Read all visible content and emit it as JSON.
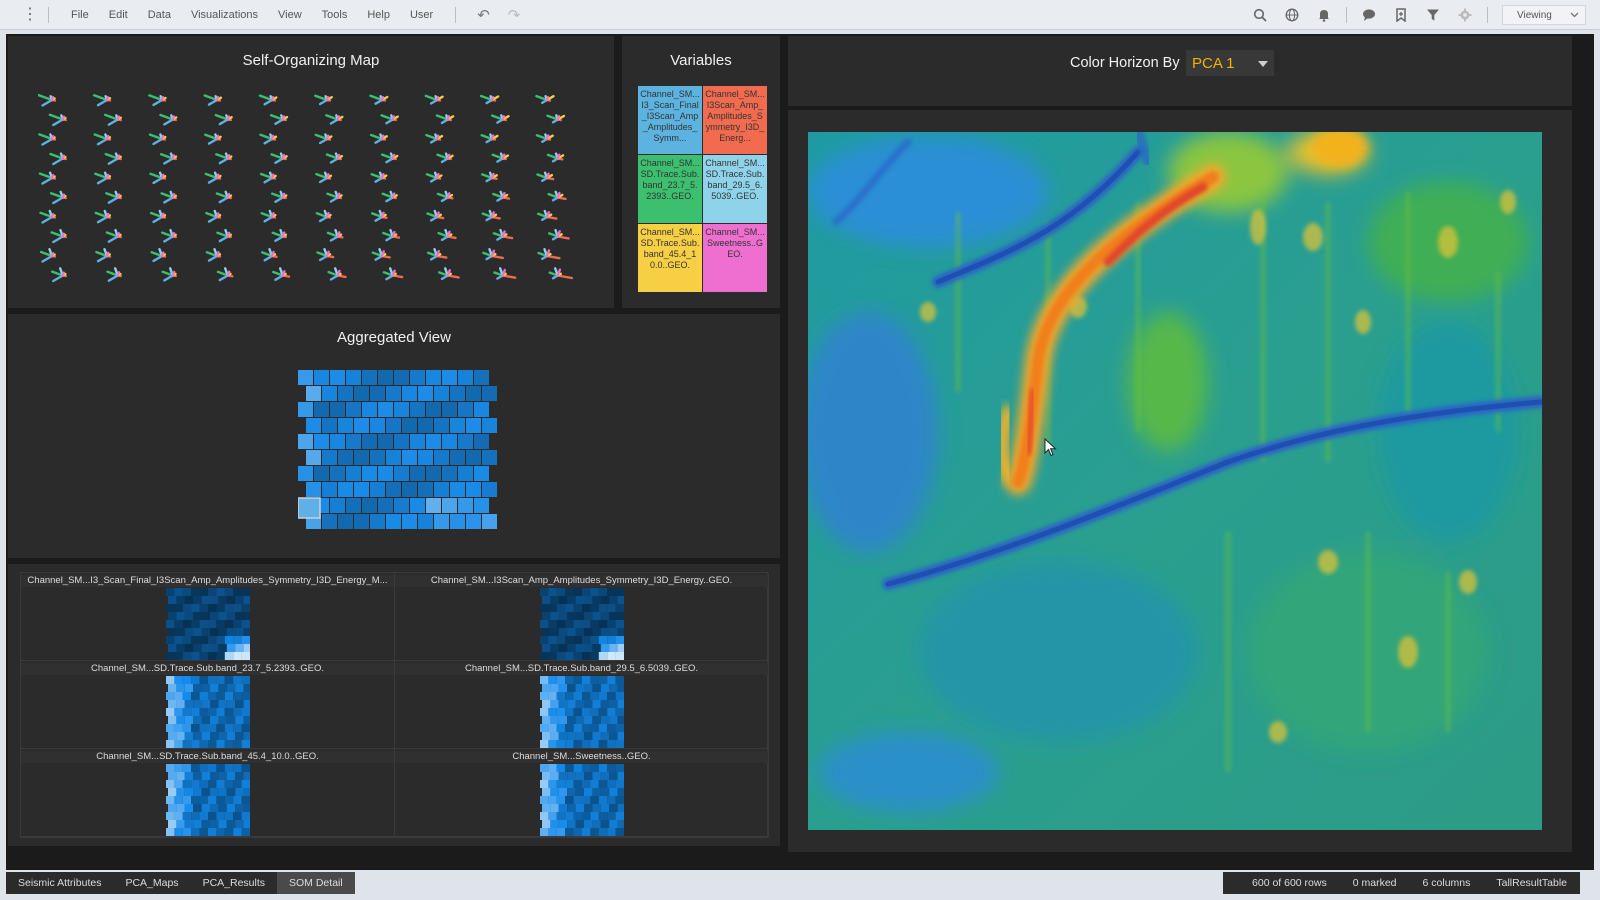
{
  "menubar": {
    "menu_items": [
      "File",
      "Edit",
      "Data",
      "Visualizations",
      "View",
      "Tools",
      "Help",
      "User"
    ],
    "icons": [
      "search-icon",
      "globe-icon",
      "bell-icon",
      "chat-icon",
      "bookmark-icon",
      "filter-icon",
      "gear-icon"
    ],
    "view_mode": "Viewing"
  },
  "som": {
    "title": "Self-Organizing Map",
    "rows": 10,
    "cols": 10
  },
  "variables": {
    "title": "Variables",
    "items": [
      {
        "label": "Channel_SM...I3_Scan_Final_I3Scan_Amp_Amplitudes_Symm...",
        "color": "#5db3df"
      },
      {
        "label": "Channel_SM...I3Scan_Amp_Amplitudes_Symmetry_I3D_Energ...",
        "color": "#f26b4f"
      },
      {
        "label": "Channel_SM...SD.Trace.Sub.band_23.7_5.2393..GEO.",
        "color": "#3cbf6e"
      },
      {
        "label": "Channel_SM...SD.Trace.Sub.band_29.5_6.5039..GEO.",
        "color": "#8fd3ea"
      },
      {
        "label": "Channel_SM...SD.Trace.Sub.band_45.4_10.0..GEO.",
        "color": "#f7cf45"
      },
      {
        "label": "Channel_SM...Sweetness..GEO.",
        "color": "#ee6fd0"
      }
    ]
  },
  "aggregated": {
    "title": "Aggregated View",
    "rows": 10,
    "cols": 12
  },
  "som_detail": {
    "cells": [
      "Channel_SM...I3_Scan_Final_I3Scan_Amp_Amplitudes_Symmetry_I3D_Energy_M...",
      "Channel_SM...I3Scan_Amp_Amplitudes_Symmetry_I3D_Energy..GEO.",
      "Channel_SM...SD.Trace.Sub.band_23.7_5.2393..GEO.",
      "Channel_SM...SD.Trace.Sub.band_29.5_6.5039..GEO.",
      "Channel_SM...SD.Trace.Sub.band_45.4_10.0..GEO.",
      "Channel_SM...Sweetness..GEO."
    ]
  },
  "color_horizon": {
    "label": "Color Horizon By",
    "selected": "PCA 1"
  },
  "tabs": [
    {
      "label": "Seismic Attributes",
      "active": false
    },
    {
      "label": "PCA_Maps",
      "active": false
    },
    {
      "label": "PCA_Results",
      "active": false
    },
    {
      "label": "SOM Detail",
      "active": true
    }
  ],
  "status": {
    "rows": "600 of 600 rows",
    "marked": "0 marked",
    "columns": "6 columns",
    "table": "TallResultTable"
  },
  "colors": {
    "accent_selected_value": "#f0b400",
    "panel_bg": "#2b2b2b",
    "workspace_bg": "#1b1b1b"
  }
}
